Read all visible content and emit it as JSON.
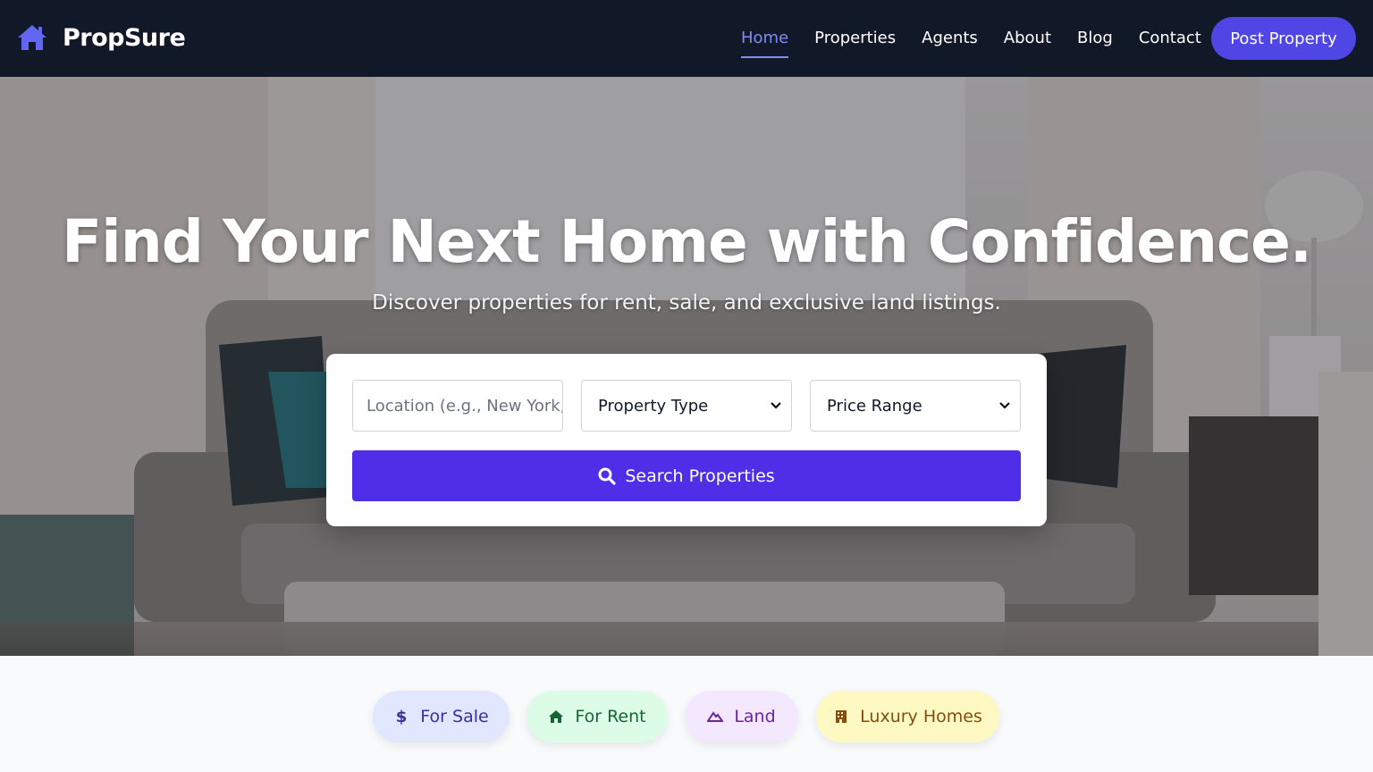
{
  "brand": {
    "name": "PropSure",
    "logo_icon": "house-icon",
    "accent": "#6366f1"
  },
  "nav": {
    "items": [
      {
        "label": "Home",
        "active": true
      },
      {
        "label": "Properties",
        "active": false
      },
      {
        "label": "Agents",
        "active": false
      },
      {
        "label": "About",
        "active": false
      },
      {
        "label": "Blog",
        "active": false
      },
      {
        "label": "Contact",
        "active": false
      }
    ],
    "cta_label": "Post Property"
  },
  "hero": {
    "title": "Find Your Next Home with Confidence.",
    "subtitle": "Discover properties for rent, sale, and exclusive land listings."
  },
  "search": {
    "location_placeholder": "Location (e.g., New York, NY)",
    "property_type": "Property Type",
    "price_range": "Price Range",
    "button_label": "Search Properties"
  },
  "categories": [
    {
      "label": "For Sale",
      "icon": "dollar-icon",
      "color": "#3730a3"
    },
    {
      "label": "For Rent",
      "icon": "house-icon",
      "color": "#166534"
    },
    {
      "label": "Land",
      "icon": "mountain-icon",
      "color": "#6b21a8"
    },
    {
      "label": "Luxury Homes",
      "icon": "building-icon",
      "color": "#854d0e"
    }
  ],
  "colors": {
    "nav_bg": "#111827",
    "primary": "#4f46e5",
    "search_button": "#4f2ee8"
  }
}
